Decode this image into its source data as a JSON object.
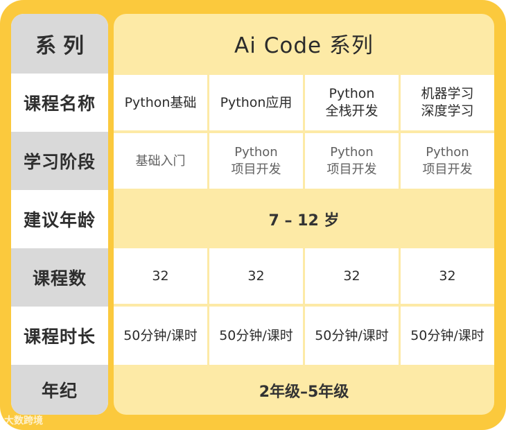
{
  "row_labels": {
    "series": "系列",
    "course_name": "课程名称",
    "stage": "学习阶段",
    "age": "建议年龄",
    "lesson_count": "课程数",
    "duration": "课程时长",
    "grade": "年纪"
  },
  "header": {
    "title": "Ai Code 系列"
  },
  "courses": [
    {
      "name_lines": [
        "Python基础"
      ],
      "stage_lines": [
        "基础入门"
      ],
      "lessons": "32",
      "duration": "50分钟/课时"
    },
    {
      "name_lines": [
        "Python应用"
      ],
      "stage_lines": [
        "Python",
        "项目开发"
      ],
      "lessons": "32",
      "duration": "50分钟/课时"
    },
    {
      "name_lines": [
        "Python",
        "全栈开发"
      ],
      "stage_lines": [
        "Python",
        "项目开发"
      ],
      "lessons": "32",
      "duration": "50分钟/课时"
    },
    {
      "name_lines": [
        "机器学习",
        "深度学习"
      ],
      "stage_lines": [
        "Python",
        "项目开发"
      ],
      "lessons": "32",
      "duration": "50分钟/课时"
    }
  ],
  "age_range": "7 – 12 岁",
  "grade_range": "2年级–5年级",
  "watermark": "大数跨境",
  "colors": {
    "frame": "#fbc93d",
    "panel": "#fdeaa6",
    "label_gray": "#d9d9d9",
    "cell_white": "#ffffff"
  }
}
